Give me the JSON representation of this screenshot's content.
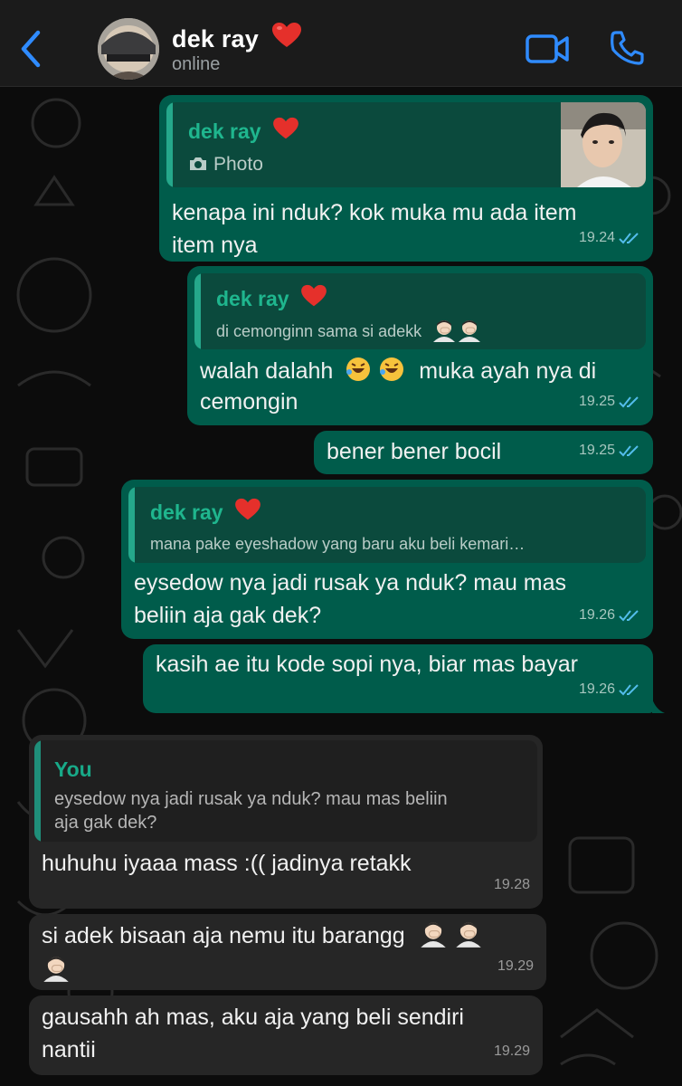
{
  "header": {
    "name": "dek ray",
    "status": "online",
    "icons": {
      "back": "chevron-left-icon",
      "video": "video-camera-icon",
      "call": "phone-icon",
      "heart": "heart-icon"
    },
    "accent": "#2f8bff"
  },
  "messages": [
    {
      "direction": "out",
      "reply": {
        "name": "dek ray",
        "text": "Photo",
        "icon": "camera-icon",
        "has_thumbnail": true
      },
      "lines": [
        "kenapa ini nduk? kok muka mu ada item",
        "item nya"
      ],
      "time": "19.24"
    },
    {
      "direction": "out",
      "reply": {
        "name": "dek ray",
        "text": "di cemonginn sama si adekk"
      },
      "lines": [
        "walah dalahh",
        "muka ayah nya di",
        "cemongin"
      ],
      "time": "19.25"
    },
    {
      "direction": "out",
      "lines": [
        "bener bener bocil"
      ],
      "time": "19.25"
    },
    {
      "direction": "out",
      "reply": {
        "name": "dek ray",
        "text": "mana pake eyeshadow yang baru aku beli kemari…"
      },
      "lines": [
        "eysedow nya jadi rusak ya nduk? mau mas",
        "beliin aja gak dek?"
      ],
      "time": "19.26"
    },
    {
      "direction": "out",
      "lines": [
        "kasih ae itu kode sopi nya, biar mas bayar"
      ],
      "time": "19.26"
    },
    {
      "direction": "in",
      "reply": {
        "name": "You",
        "text_lines": [
          "eysedow nya jadi rusak ya nduk? mau mas beliin",
          "aja gak dek?"
        ]
      },
      "lines": [
        "huhuhu iyaaa mass :(( jadinya retakk"
      ],
      "time": "19.28"
    },
    {
      "direction": "in",
      "lines": [
        "si adek bisaan aja nemu itu barangg"
      ],
      "time": "19.29"
    },
    {
      "direction": "in",
      "lines": [
        "gausahh ah mas, aku aja yang beli sendiri",
        "nantii"
      ],
      "time": "19.29"
    }
  ],
  "colors": {
    "outgoing_bubble": "#005c4b",
    "incoming_bubble": "#262626",
    "quote_name": "#1fb68e",
    "read_ticks": "#53bdeb"
  }
}
